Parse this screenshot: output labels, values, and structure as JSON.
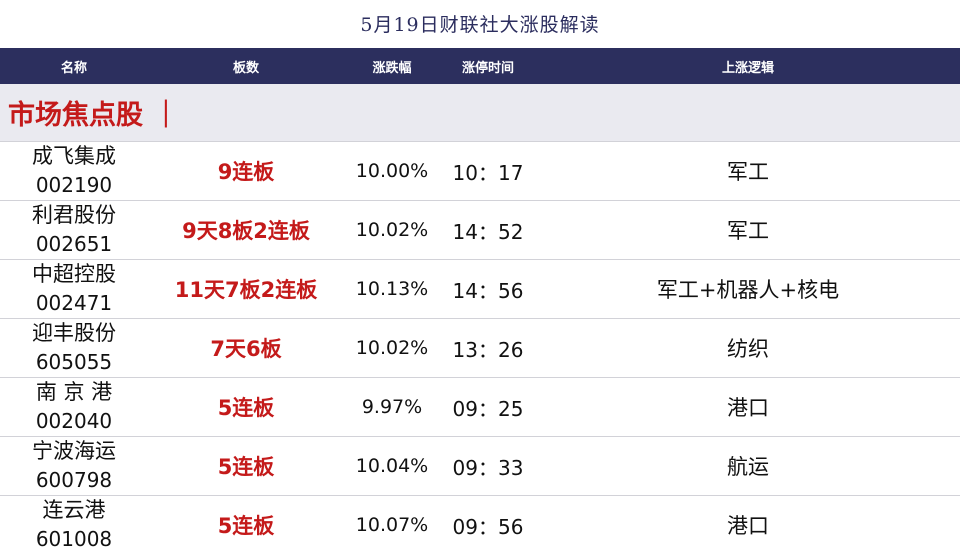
{
  "title": "5月19日财联社大涨股解读",
  "columns": [
    "名称",
    "板数",
    "涨跌幅",
    "涨停时间",
    "上涨逻辑"
  ],
  "section_title": "市场焦点股 ｜",
  "rows": [
    {
      "name": "成飞集成",
      "code": "002190",
      "boards": "9连板",
      "pct": "10.00%",
      "time": "10：17",
      "logic": "军工"
    },
    {
      "name": "利君股份",
      "code": "002651",
      "boards": "9天8板2连板",
      "pct": "10.02%",
      "time": "14：52",
      "logic": "军工"
    },
    {
      "name": "中超控股",
      "code": "002471",
      "boards": "11天7板2连板",
      "pct": "10.13%",
      "time": "14：56",
      "logic": "军工+机器人+核电"
    },
    {
      "name": "迎丰股份",
      "code": "605055",
      "boards": "7天6板",
      "pct": "10.02%",
      "time": "13：26",
      "logic": "纺织"
    },
    {
      "name": "南 京 港",
      "code": "002040",
      "boards": "5连板",
      "pct": "9.97%",
      "time": "09：25",
      "logic": "港口"
    },
    {
      "name": "宁波海运",
      "code": "600798",
      "boards": "5连板",
      "pct": "10.04%",
      "time": "09：33",
      "logic": "航运"
    },
    {
      "name": "连云港",
      "code": "601008",
      "boards": "5连板",
      "pct": "10.07%",
      "time": "09：56",
      "logic": "港口"
    }
  ]
}
